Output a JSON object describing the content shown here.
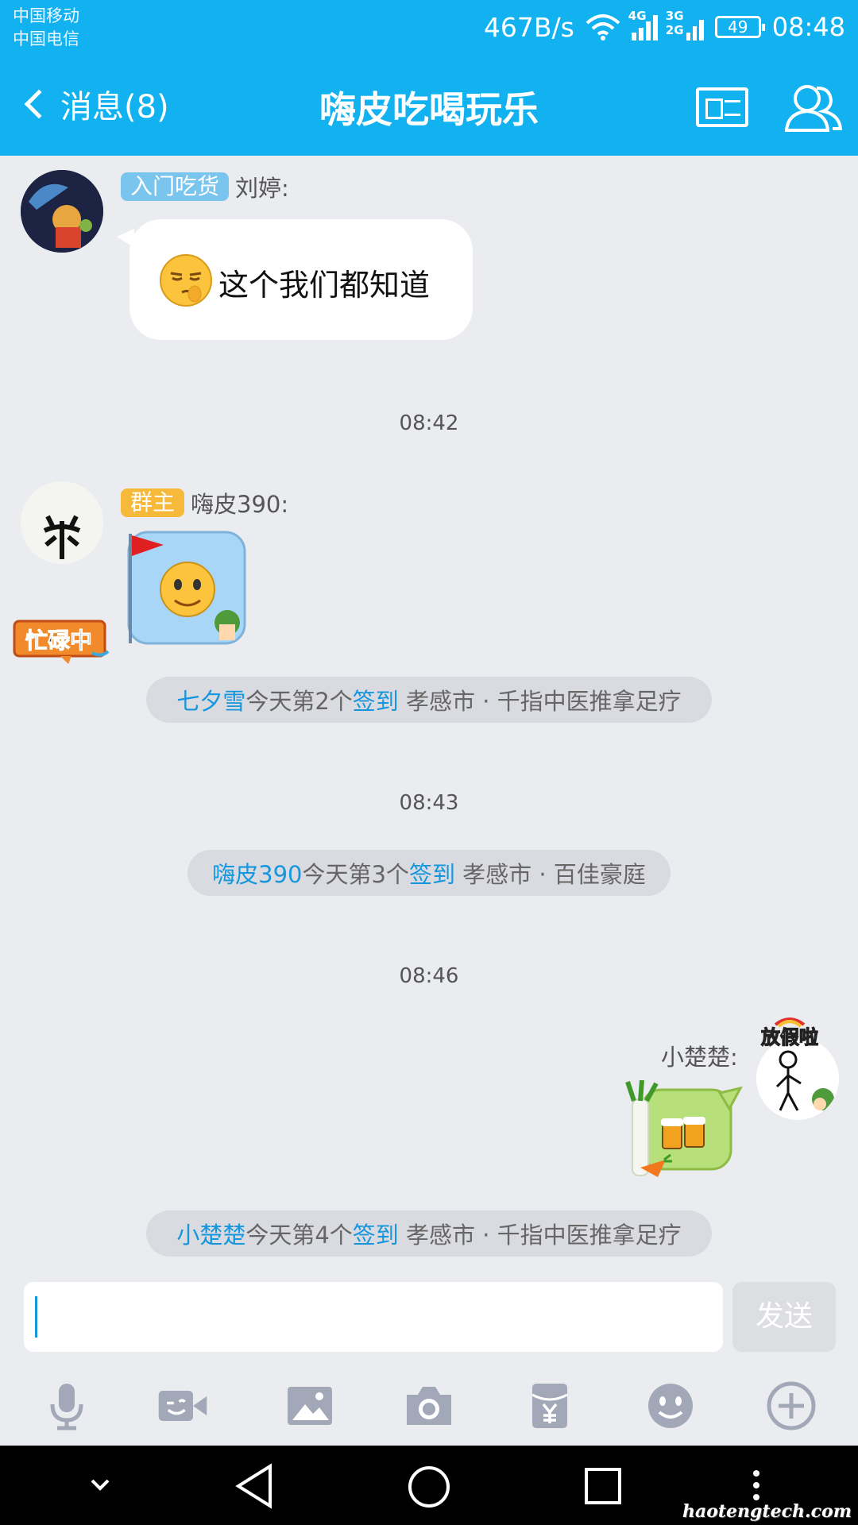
{
  "status_bar": {
    "carrier1": "中国移动",
    "carrier2": "中国电信",
    "speed": "467B/s",
    "net1": "4G",
    "net2": "3G",
    "net3": "2G",
    "battery": "49",
    "time": "08:48"
  },
  "header": {
    "back_label": "消息(8)",
    "title": "嗨皮吃喝玩乐"
  },
  "messages": {
    "m1": {
      "badge": "入门吃货",
      "sender": "刘婷:",
      "text": "这个我们都知道"
    },
    "t1": "08:42",
    "m2": {
      "badge": "群主",
      "sender": "嗨皮390:"
    },
    "n1": {
      "user": "七夕雪",
      "mid": "今天第2个",
      "action": "签到",
      "place": " 孝感市 · 千指中医推拿足疗"
    },
    "t2": "08:43",
    "n2": {
      "user": "嗨皮390",
      "mid": "今天第3个",
      "action": "签到",
      "place": " 孝感市 · 百佳豪庭"
    },
    "t3": "08:46",
    "m3": {
      "sender": "小楚楚:"
    },
    "n3": {
      "user": "小楚楚",
      "mid": "今天第4个",
      "action": "签到",
      "place": " 孝感市 · 千指中医推拿足疗"
    }
  },
  "avatars": {
    "a2_tag": "忙碌中",
    "a3_tag": "放假啦"
  },
  "input": {
    "value": "",
    "send_label": "发送"
  },
  "toolbar": [
    "mic-icon",
    "video-icon",
    "image-icon",
    "camera-icon",
    "red-packet-icon",
    "emoji-icon",
    "plus-icon"
  ],
  "watermark": "haotengtech.com",
  "colors": {
    "accent": "#12b1f0",
    "link": "#1596dd",
    "background": "#eaecf0"
  }
}
